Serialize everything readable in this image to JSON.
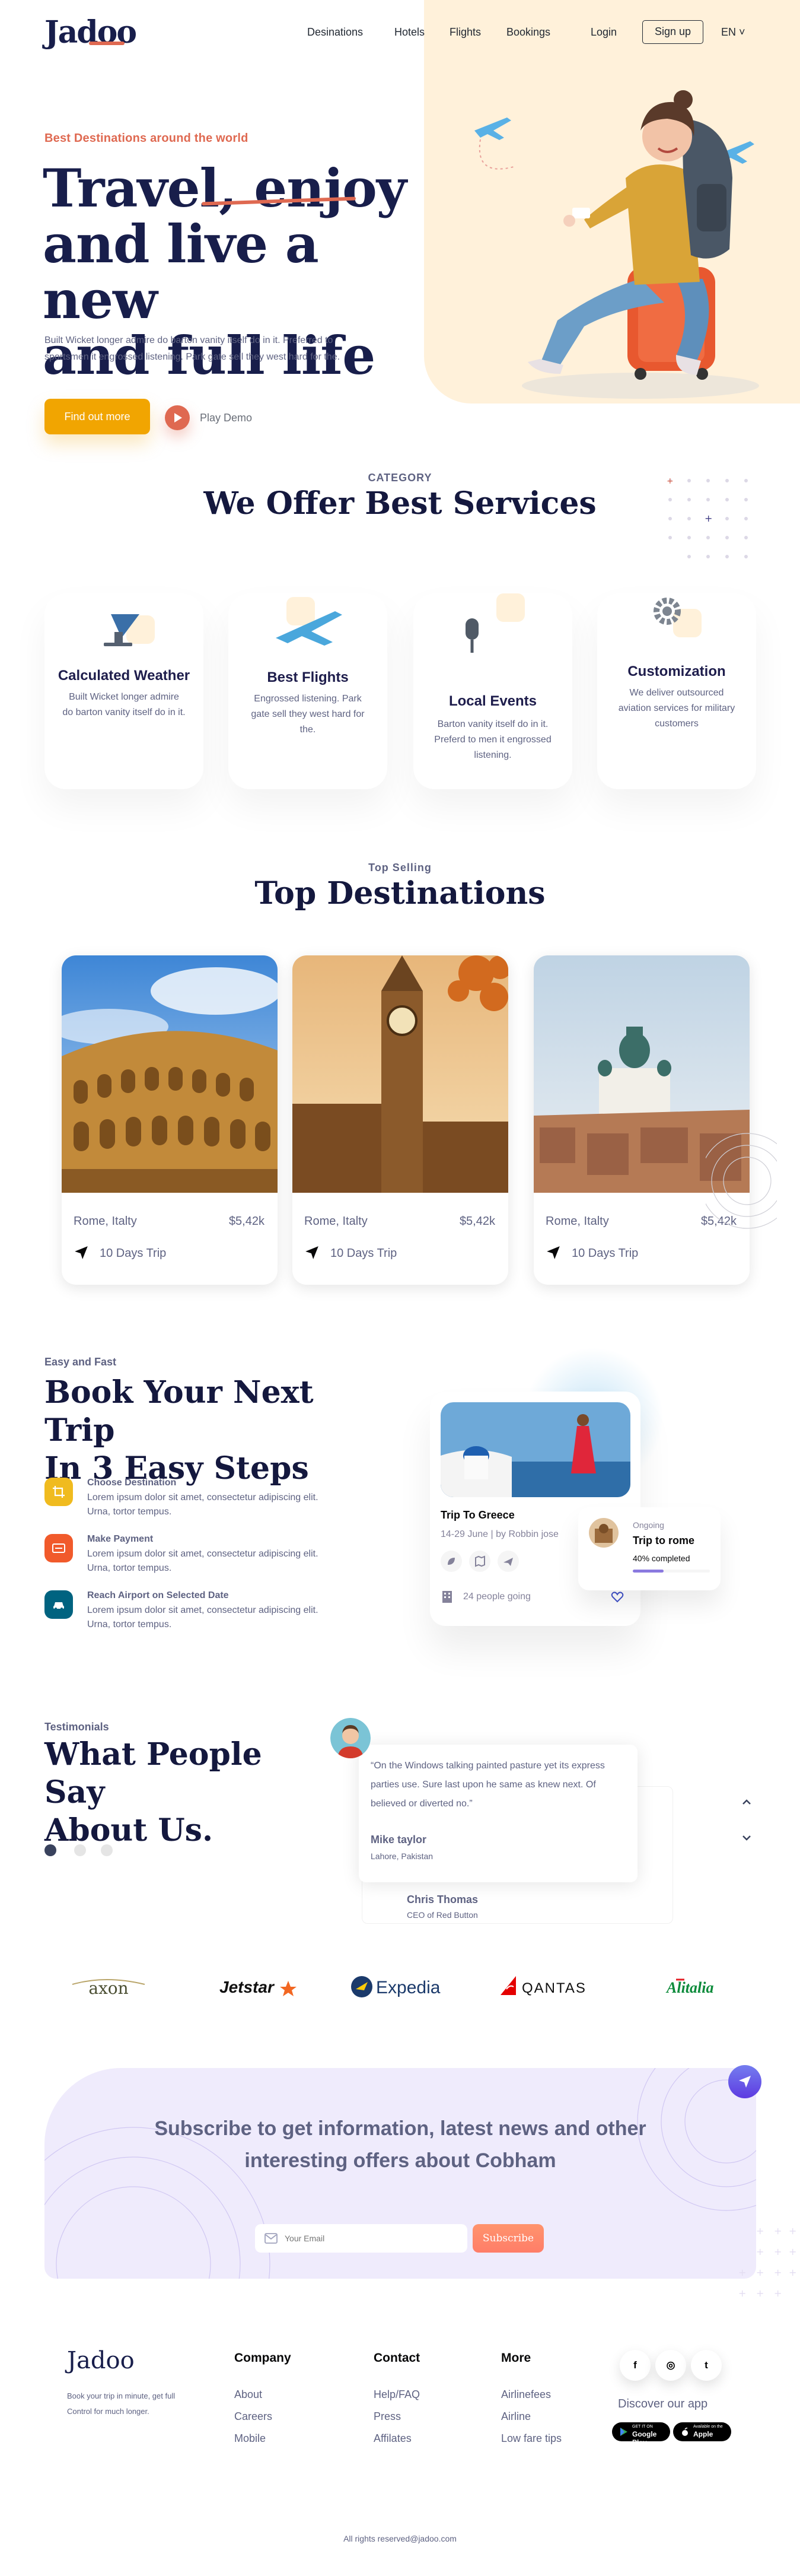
{
  "nav": {
    "logo": "Jadoo",
    "links": [
      "Desinations",
      "Hotels",
      "Flights",
      "Bookings"
    ],
    "login": "Login",
    "signup": "Sign up",
    "lang": "EN ˅"
  },
  "hero": {
    "kicker": "Best Destinations around the world",
    "title_line1": "Travel, enjoy",
    "title_line2": "and live a new",
    "title_line3": "and full life",
    "description": "Built Wicket longer admire do barton vanity itself do in it. Preferred to sportsmen it engrossed listening. Park gate sell they west hard for the.",
    "cta": "Find out more",
    "play_label": "Play Demo"
  },
  "services": {
    "kicker": "CATEGORY",
    "title": "We Offer Best Services",
    "items": [
      {
        "name": "Calculated Weather",
        "desc": "Built Wicket longer admire do barton vanity itself do in it.",
        "icon": "satellite-dish-icon"
      },
      {
        "name": "Best Flights",
        "desc": "Engrossed listening. Park gate sell they west hard for the.",
        "icon": "plane-icon"
      },
      {
        "name": "Local Events",
        "desc": "Barton vanity itself do in it. Preferd to men it engrossed listening.",
        "icon": "microphone-icon"
      },
      {
        "name": "Customization",
        "desc": "We deliver outsourced aviation services for military customers",
        "icon": "gear-icon"
      }
    ]
  },
  "destinations": {
    "kicker": "Top Selling",
    "title": "Top Destinations",
    "items": [
      {
        "city": "Rome, Italty",
        "price": "$5,42k",
        "trip": "10 Days Trip"
      },
      {
        "city": "Rome, Italty",
        "price": "$5,42k",
        "trip": "10 Days Trip"
      },
      {
        "city": "Rome, Italty",
        "price": "$5,42k",
        "trip": "10 Days Trip"
      }
    ]
  },
  "booking": {
    "kicker": "Easy and Fast",
    "title_line1": "Book Your Next Trip",
    "title_line2": "In 3 Easy Steps",
    "steps": [
      {
        "title": "Choose Destination",
        "desc": "Lorem ipsum dolor sit amet, consectetur adipiscing elit. Urna, tortor tempus.",
        "color": "#F0BB1F"
      },
      {
        "title": "Make Payment",
        "desc": "Lorem ipsum dolor sit amet, consectetur adipiscing elit. Urna, tortor tempus.",
        "color": "#F15A2B"
      },
      {
        "title": "Reach Airport on Selected Date",
        "desc": "Lorem ipsum dolor sit amet, consectetur adipiscing elit. Urna, tortor tempus.",
        "color": "#006380"
      }
    ],
    "trip_card": {
      "title": "Trip To Greece",
      "meta": "14-29 June  |  by Robbin jose",
      "people": "24 people going"
    },
    "ongoing": {
      "label": "Ongoing",
      "title": "Trip to rome",
      "progress_text": "40% completed",
      "progress": 0.4
    }
  },
  "testimonials": {
    "kicker": "Testimonials",
    "title_line1": "What People Say",
    "title_line2": "About Us.",
    "front": {
      "quote": "“On the Windows talking painted pasture yet its express parties use. Sure last upon he same as knew next. Of believed or diverted no.”",
      "name": "Mike taylor",
      "role": "Lahore, Pakistan"
    },
    "back": {
      "name": "Chris Thomas",
      "role": "CEO of Red Button"
    }
  },
  "partners": [
    "axon",
    "Jetstar",
    "Expedia",
    "QANTAS",
    "Alitalia"
  ],
  "subscribe": {
    "title": "Subscribe to get information, latest news and other interesting offers about Cobham",
    "placeholder": "Your Email",
    "button": "Subscribe"
  },
  "footer": {
    "logo": "Jadoo",
    "desc": "Book your trip in minute, get full Control for much longer.",
    "company": {
      "title": "Company",
      "links": [
        "About",
        "Careers",
        "Mobile"
      ]
    },
    "contact": {
      "title": "Contact",
      "links": [
        "Help/FAQ",
        "Press",
        "Affilates"
      ]
    },
    "more": {
      "title": "More",
      "links": [
        "Airlinefees",
        "Airline",
        "Low fare tips"
      ]
    },
    "social": [
      "f",
      "◎",
      "t"
    ],
    "discover": "Discover our app",
    "google_play": {
      "small": "GET IT ON",
      "big": "Google Play"
    },
    "app_store": {
      "small": "Available on the",
      "big": "Apple"
    },
    "copyright": "All rights reserved@jadoo.com"
  },
  "colors": {
    "accent": "#DF6951",
    "navy": "#181E4B",
    "cta": "#F1A501",
    "muted": "#5E6282",
    "peach": "#FFF1DA"
  }
}
